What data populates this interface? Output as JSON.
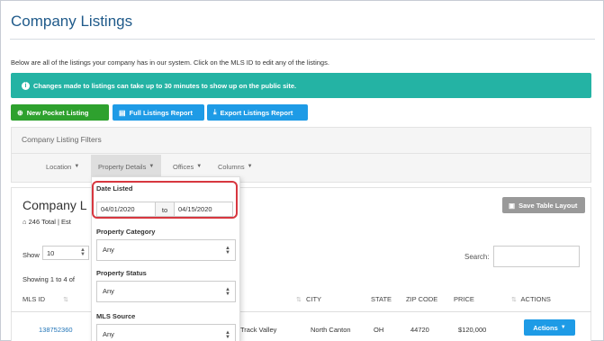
{
  "page": {
    "title": "Company Listings",
    "intro": "Below are all of the listings your company has in our system. Click on the MLS ID to edit any of the listings.",
    "alert": "Changes made to listings can take up to 30 minutes to show up on the public site."
  },
  "toolbar": {
    "new_pocket": "New Pocket Listing",
    "full_report": "Full Listings Report",
    "export_report": "Export Listings Report"
  },
  "filters": {
    "title": "Company Listing Filters",
    "tabs": [
      {
        "label": "Location"
      },
      {
        "label": "Property Details"
      },
      {
        "label": "Offices"
      },
      {
        "label": "Columns"
      }
    ]
  },
  "listings": {
    "title": "Company L",
    "summary": "246 Total | Est",
    "save_layout": "Save Table Layout",
    "show_label": "Show",
    "show_value": "10",
    "showing_text": "Showing 1 to 4 of",
    "search_label": "Search:",
    "columns": [
      "MLS ID",
      "CITY",
      "STATE",
      "ZIP CODE",
      "PRICE",
      "ACTIONS"
    ],
    "row": {
      "mls_id": "138752360",
      "street": "Track Valley",
      "city": "North Canton",
      "state": "OH",
      "zip": "44720",
      "price": "$120,000",
      "actions": "Actions"
    }
  },
  "dropdown": {
    "date_listed_label": "Date Listed",
    "date_from": "04/01/2020",
    "date_to_label": "to",
    "date_to": "04/15/2020",
    "property_category_label": "Property Category",
    "property_category_value": "Any",
    "property_status_label": "Property Status",
    "property_status_value": "Any",
    "mls_source_label": "MLS Source",
    "mls_source_value": "Any"
  },
  "colors": {
    "alert": "#24b3a4",
    "green_button": "#2ea12e",
    "blue_button": "#1e9be6",
    "highlight": "#d7373f"
  }
}
